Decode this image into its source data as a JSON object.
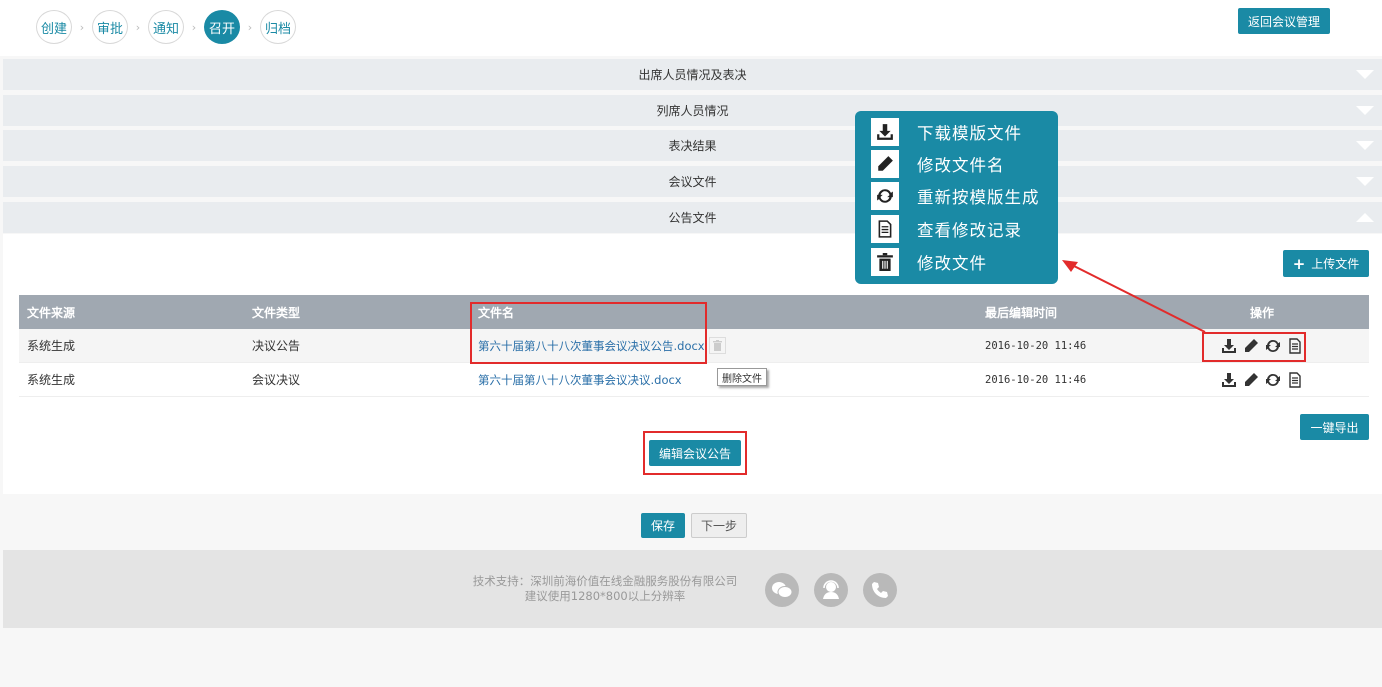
{
  "steps": [
    "创建",
    "审批",
    "通知",
    "召开",
    "归档"
  ],
  "active_step": 3,
  "back_button": "返回会议管理",
  "sections": [
    "出席人员情况及表决",
    "列席人员情况",
    "表决结果",
    "会议文件",
    "公告文件"
  ],
  "upload_button": "上传文件",
  "table": {
    "headers": [
      "文件来源",
      "文件类型",
      "文件名",
      "最后编辑时间",
      "操作"
    ],
    "rows": [
      {
        "source": "系统生成",
        "type": "决议公告",
        "name": "第六十届第八十八次董事会议决议公告.docx",
        "time": "2016-10-20 11:46"
      },
      {
        "source": "系统生成",
        "type": "会议决议",
        "name": "第六十届第八十八次董事会议决议.docx",
        "time": "2016-10-20 11:46"
      }
    ]
  },
  "tooltip": "删除文件",
  "export_button": "一键导出",
  "edit_notice_button": "编辑会议公告",
  "save_button": "保存",
  "next_button": "下一步",
  "footer": {
    "support": "技术支持：深圳前海价值在线金融服务股份有限公司",
    "resolution": "建议使用1280*800以上分辨率"
  },
  "legend": [
    {
      "icon": "download-icon",
      "label": "下载模版文件"
    },
    {
      "icon": "pencil-icon",
      "label": "修改文件名"
    },
    {
      "icon": "refresh-icon",
      "label": "重新按模版生成"
    },
    {
      "icon": "document-icon",
      "label": "查看修改记录"
    },
    {
      "icon": "trash-icon",
      "label": "修改文件"
    }
  ],
  "colors": {
    "accent": "#1a8aa5",
    "highlight": "#e22b2b"
  }
}
